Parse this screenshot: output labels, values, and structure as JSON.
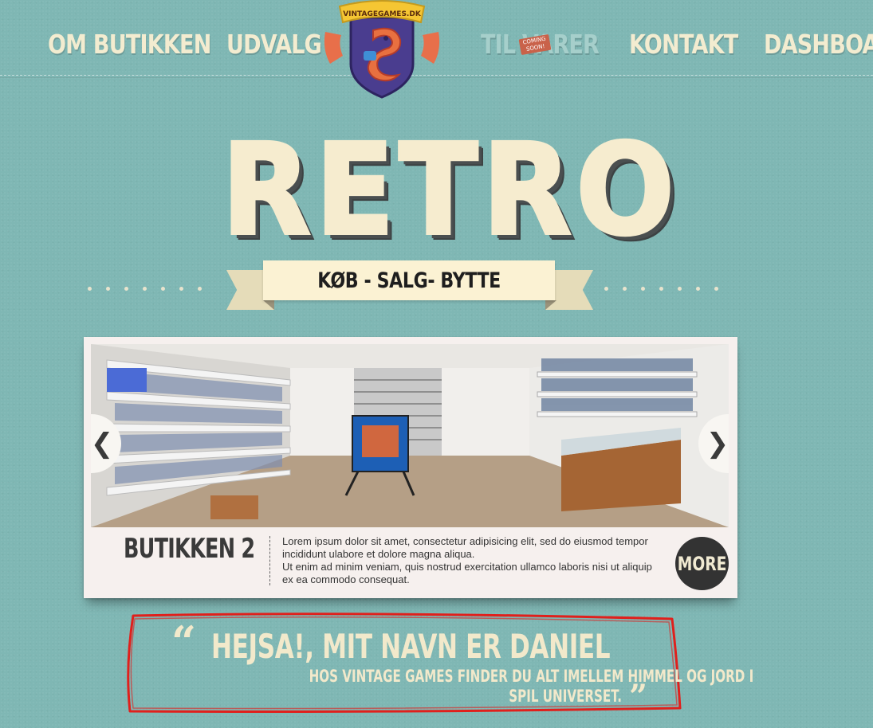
{
  "nav": {
    "items": [
      {
        "label": "OM BUTIKKEN"
      },
      {
        "label": "UDVALG"
      },
      {
        "label": "TIL VARER",
        "badge": "COMING SOON!"
      },
      {
        "label": "KONTAKT"
      },
      {
        "label": "DASHBOARD"
      }
    ],
    "logo_text": "VINTAGEGAMES.DK"
  },
  "hero": {
    "title": "RETRO",
    "ribbon": "KØB - SALG- BYTTE"
  },
  "slider": {
    "slide_title": "BUTIKKEN 2",
    "text_line1": "Lorem ipsum dolor sit amet, consectetur adipisicing elit, sed do eiusmod tempor incididunt ulabore et dolore magna aliqua.",
    "text_line2": "Ut enim ad minim veniam, quis nostrud exercitation ullamco laboris nisi ut aliquip ex ea commodo consequat.",
    "prev_arrow": "❮",
    "next_arrow": "❯",
    "more_label": "MORE"
  },
  "quote": {
    "open_mark": "“",
    "close_mark": "”",
    "heading": "HEJSA!, MIT NAVN ER DANIEL",
    "line1": "HOS VINTAGE GAMES FINDER DU ALT IMELLEM HIMMEL OG JORD I",
    "line2": "SPIL UNIVERSET."
  },
  "colors": {
    "background": "#7fb7b4",
    "cream": "#f6eccf",
    "dark": "#333333",
    "annotation_red": "#e0201c"
  }
}
